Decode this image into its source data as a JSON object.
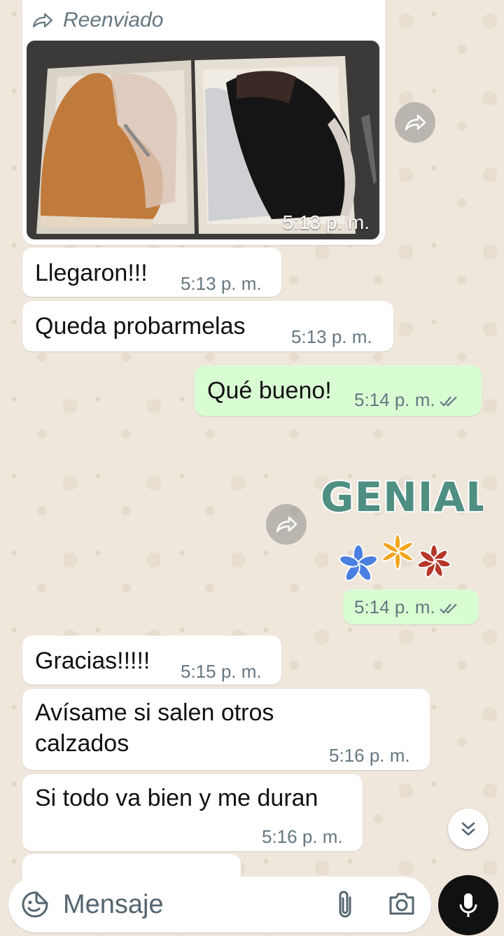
{
  "forwarded_photo": {
    "forwarded_label": "Reenviado",
    "time": "5:13 p. m."
  },
  "messages": [
    {
      "direction": "in",
      "text": "Llegaron!!!",
      "time": "5:13 p. m."
    },
    {
      "direction": "in",
      "text": "Queda probarmelas",
      "time": "5:13 p. m."
    },
    {
      "direction": "out",
      "text": "Qué bueno!",
      "time": "5:14 p. m.",
      "status": "read"
    },
    {
      "direction": "in",
      "text": "Gracias!!!!!",
      "time": "5:15 p. m."
    },
    {
      "direction": "in",
      "text_line1": "Avísame si salen otros",
      "text_line2": "calzados",
      "time": "5:16 p. m."
    },
    {
      "direction": "in",
      "text": "Si todo va bien y me duran",
      "time": "5:16 p. m."
    }
  ],
  "sticker": {
    "text": "GENIAL",
    "time": "5:14 p. m.",
    "colors": [
      "#4f8f82",
      "#4a7fe0",
      "#f2a51c",
      "#b5382a"
    ]
  },
  "composer": {
    "placeholder": "Mensaje"
  },
  "icons": {
    "forward": "forward-icon",
    "sticker": "sticker-icon",
    "attach": "paperclip-icon",
    "camera": "camera-icon",
    "mic": "microphone-icon",
    "scroll": "double-chevron-down-icon"
  },
  "colors": {
    "incoming_bubble": "#ffffff",
    "outgoing_bubble": "#d9fdd3",
    "wallpaper": "#efe7dc",
    "timestamp": "#667781"
  }
}
